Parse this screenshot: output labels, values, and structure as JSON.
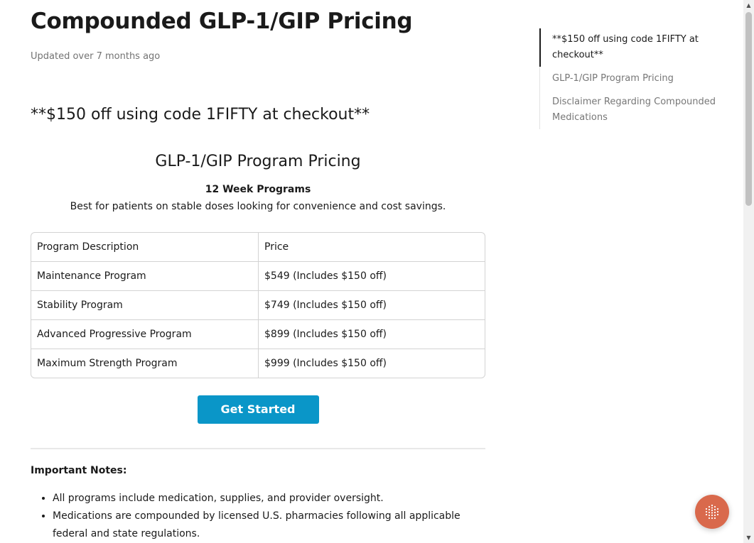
{
  "article": {
    "title": "Compounded GLP-1/GIP Pricing",
    "updated": "Updated over 7 months ago",
    "promo": "**$150 off using code 1FIFTY at checkout**",
    "section_title": "GLP-1/GIP Program Pricing",
    "program_heading": "12 Week Programs",
    "program_description": "Best for patients on stable doses looking for convenience and cost savings.",
    "table": {
      "headers": [
        "Program Description",
        "Price"
      ],
      "rows": [
        [
          "Maintenance Program",
          "$549 (Includes $150 off)"
        ],
        [
          "Stability Program",
          "$749 (Includes $150 off)"
        ],
        [
          "Advanced Progressive Program",
          "$899 (Includes $150 off)"
        ],
        [
          "Maximum Strength Program",
          "$999 (Includes $150 off)"
        ]
      ]
    },
    "cta_label": "Get Started",
    "notes_heading": "Important Notes:",
    "notes": [
      "All programs include medication, supplies, and provider oversight.",
      "Medications are compounded by licensed U.S. pharmacies following all applicable federal and state regulations."
    ]
  },
  "toc": {
    "items": [
      {
        "label": "**$150 off using code 1FIFTY at checkout**",
        "active": true
      },
      {
        "label": "GLP-1/GIP Program Pricing",
        "active": false
      },
      {
        "label": "Disclaimer Regarding Compounded Medications",
        "active": false
      }
    ]
  },
  "icons": {
    "chat_launcher": "chat-launcher-icon",
    "scroll_up": "scroll-up-arrow-icon",
    "scroll_down": "scroll-down-arrow-icon"
  },
  "colors": {
    "cta_background": "#0a96c8",
    "chat_launcher_background": "#d9694c",
    "muted_text": "#737373"
  }
}
